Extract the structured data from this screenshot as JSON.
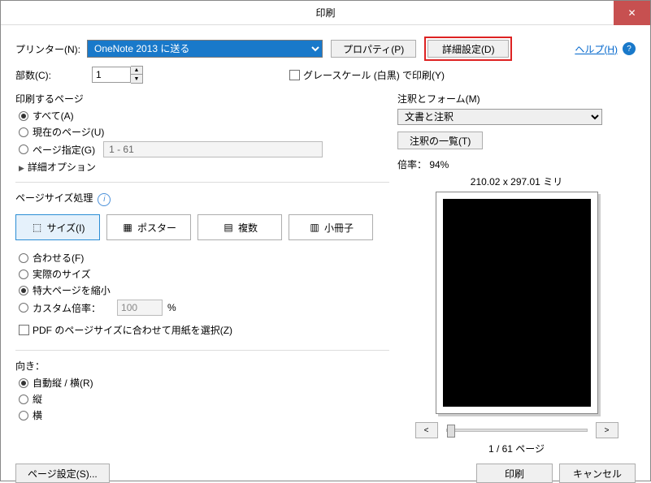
{
  "title": "印刷",
  "close": "✕",
  "printer_label": "プリンター(N):",
  "printer_value": "OneNote 2013 に送る",
  "properties_btn": "プロパティ(P)",
  "advanced_btn": "詳細設定(D)",
  "help": "ヘルプ(H)",
  "copies_label": "部数(C):",
  "copies_value": "1",
  "grayscale": "グレースケール (白黒) で印刷(Y)",
  "pages_group": "印刷するページ",
  "all": "すべて(A)",
  "current": "現在のページ(U)",
  "range": "ページ指定(G)",
  "range_value": "1 - 61",
  "more_options": "詳細オプション",
  "sizing_group": "ページサイズ処理",
  "tab_size": "サイズ(I)",
  "tab_poster": "ポスター",
  "tab_multiple": "複数",
  "tab_booklet": "小冊子",
  "fit": "合わせる(F)",
  "actual": "実際のサイズ",
  "shrink": "特大ページを縮小",
  "custom_scale": "カスタム倍率：",
  "custom_scale_value": "100",
  "percent": "%",
  "choose_paper": "PDF のページサイズに合わせて用紙を選択(Z)",
  "orient_group": "向き：",
  "auto": "自動縦 / 横(R)",
  "portrait": "縦",
  "landscape": "横",
  "comments_group": "注釈とフォーム(M)",
  "comments_value": "文書と注釈",
  "annot_list_btn": "注釈の一覧(T)",
  "scale_text": "倍率： 94%",
  "page_dim": "210.02 x 297.01 ミリ",
  "prev": "<",
  "next": ">",
  "page_indicator": "1 / 61 ページ",
  "page_setup": "ページ設定(S)...",
  "print_btn": "印刷",
  "cancel_btn": "キャンセル"
}
